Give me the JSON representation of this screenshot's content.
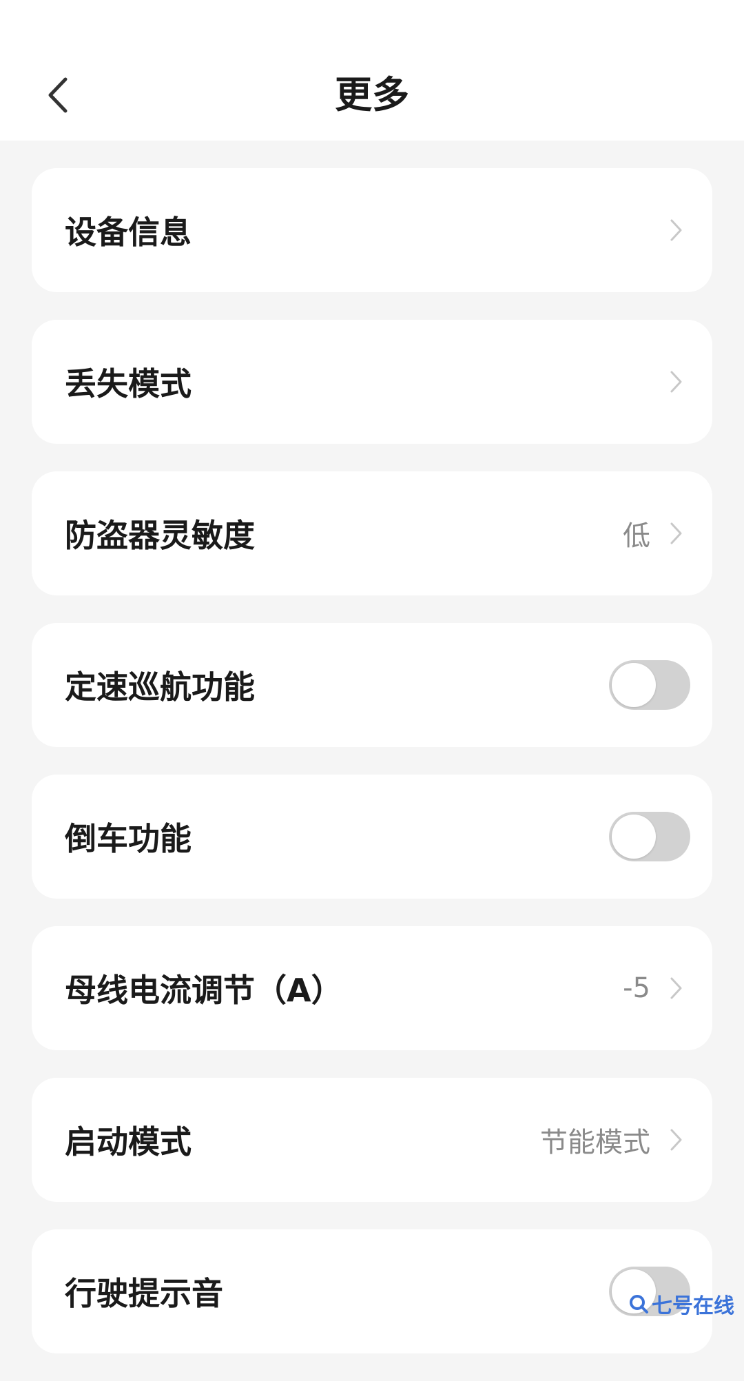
{
  "header": {
    "title": "更多"
  },
  "items": [
    {
      "label": "设备信息",
      "type": "link",
      "value": ""
    },
    {
      "label": "丢失模式",
      "type": "link",
      "value": ""
    },
    {
      "label": "防盗器灵敏度",
      "type": "link",
      "value": "低"
    },
    {
      "label": "定速巡航功能",
      "type": "toggle",
      "on": false
    },
    {
      "label": "倒车功能",
      "type": "toggle",
      "on": false
    },
    {
      "label": "母线电流调节（A）",
      "type": "link",
      "value": "-5"
    },
    {
      "label": "启动模式",
      "type": "link",
      "value": "节能模式"
    },
    {
      "label": "行驶提示音",
      "type": "toggle",
      "on": false
    }
  ],
  "watermark": {
    "text": "七号在线"
  },
  "colors": {
    "background": "#f5f5f5",
    "card": "#ffffff",
    "toggle_off": "#d2d2d2",
    "watermark": "#3b73d9"
  }
}
